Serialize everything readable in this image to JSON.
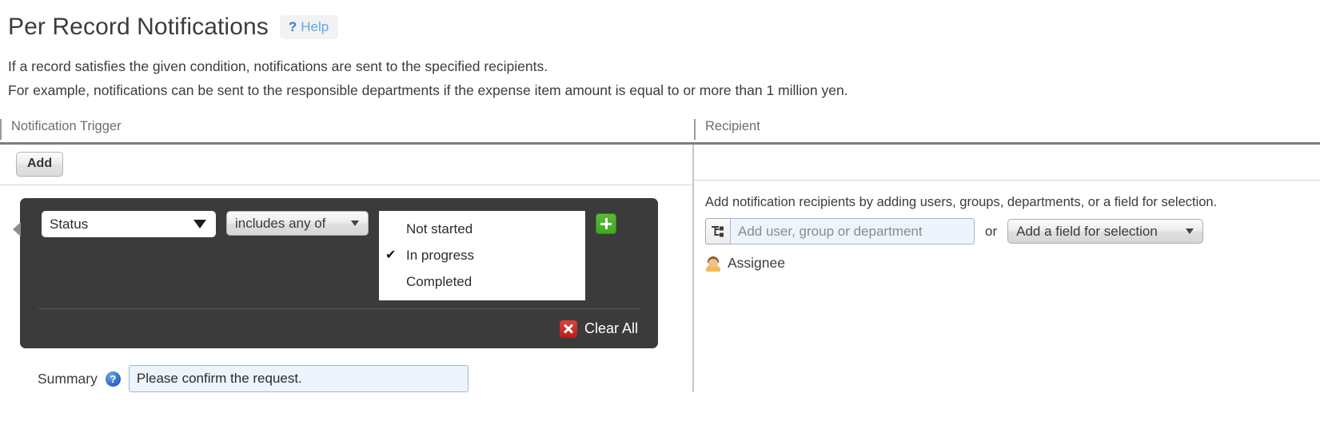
{
  "header": {
    "title": "Per Record Notifications",
    "help_q": "?",
    "help_label": "Help"
  },
  "description": {
    "line1": "If a record satisfies the given condition, notifications are sent to the specified recipients.",
    "line2": "For example, notifications can be sent to the responsible departments if the expense item amount is equal to or more than 1 million yen."
  },
  "table": {
    "columns": {
      "trigger": "Notification Trigger",
      "recipient": "Recipient"
    }
  },
  "trigger": {
    "add_button": "Add",
    "condition": {
      "field": {
        "value": "Status"
      },
      "operator": {
        "value": "includes any of"
      },
      "options": [
        {
          "label": "Not started",
          "checked": ""
        },
        {
          "label": "In progress",
          "checked": "✔"
        },
        {
          "label": "Completed",
          "checked": ""
        }
      ],
      "add_value_icon": "plus-icon",
      "clear_all": {
        "icon": "close-x-icon",
        "label": "Clear All"
      }
    },
    "summary": {
      "label": "Summary",
      "help_icon": "question-circle-icon",
      "value": "Please confirm the request."
    }
  },
  "recipient": {
    "description": "Add notification recipients by adding users, groups, departments, or a field for selection.",
    "picker": {
      "icon": "org-tree-icon",
      "placeholder": "Add user, group or department",
      "value": ""
    },
    "or_label": "or",
    "field_select": {
      "value": "Add a field for selection"
    },
    "entries": [
      {
        "icon": "user-avatar-icon",
        "label": "Assignee"
      }
    ]
  },
  "colors": {
    "panel_dark": "#3b3b3b",
    "accent_green": "#3faa21",
    "accent_red": "#b4201b",
    "link_blue": "#63a6e8",
    "input_blue_bg": "#eef4fb"
  }
}
